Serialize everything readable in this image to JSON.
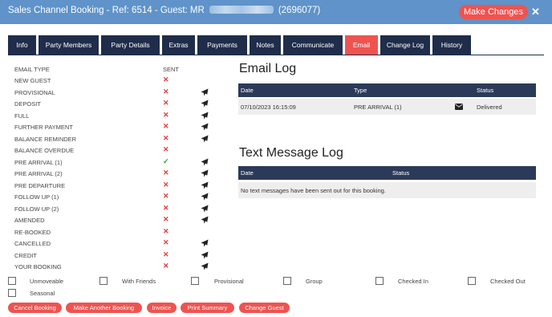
{
  "header": {
    "title_prefix": "Sales Channel Booking - Ref: 6514 - Guest: MR",
    "title_suffix": "(2696077)",
    "make_changes_label": "Make Changes",
    "close_glyph": "✕"
  },
  "tabs": [
    {
      "label": "Info"
    },
    {
      "label": "Party Members"
    },
    {
      "label": "Party Details"
    },
    {
      "label": "Extras"
    },
    {
      "label": "Payments"
    },
    {
      "label": "Notes"
    },
    {
      "label": "Communicate"
    },
    {
      "label": "Email",
      "active": true
    },
    {
      "label": "Change Log"
    },
    {
      "label": "History"
    }
  ],
  "email_types": {
    "header_type": "EMAIL TYPE",
    "header_sent": "SENT",
    "rows": [
      {
        "label": "NEW GUEST",
        "sent": false,
        "can_send": false
      },
      {
        "label": "PROVISIONAL",
        "sent": false,
        "can_send": true
      },
      {
        "label": "DEPOSIT",
        "sent": false,
        "can_send": true
      },
      {
        "label": "FULL",
        "sent": false,
        "can_send": true
      },
      {
        "label": "FURTHER PAYMENT",
        "sent": false,
        "can_send": true
      },
      {
        "label": "BALANCE REMINDER",
        "sent": false,
        "can_send": true
      },
      {
        "label": "BALANCE OVERDUE",
        "sent": false,
        "can_send": false
      },
      {
        "label": "PRE ARRIVAL (1)",
        "sent": true,
        "can_send": true
      },
      {
        "label": "PRE ARRIVAL (2)",
        "sent": false,
        "can_send": true
      },
      {
        "label": "PRE DEPARTURE",
        "sent": false,
        "can_send": true
      },
      {
        "label": "FOLLOW UP (1)",
        "sent": false,
        "can_send": true
      },
      {
        "label": "FOLLOW UP (2)",
        "sent": false,
        "can_send": true
      },
      {
        "label": "AMENDED",
        "sent": false,
        "can_send": true
      },
      {
        "label": "RE-BOOKED",
        "sent": false,
        "can_send": false
      },
      {
        "label": "CANCELLED",
        "sent": false,
        "can_send": true
      },
      {
        "label": "CREDIT",
        "sent": false,
        "can_send": true
      },
      {
        "label": "YOUR BOOKING",
        "sent": false,
        "can_send": true
      }
    ]
  },
  "email_log": {
    "heading": "Email Log",
    "col_date": "Date",
    "col_type": "Type",
    "col_status": "Status",
    "rows": [
      {
        "date": "07/10/2023 16:15:09",
        "type": "PRE ARRIVAL (1)",
        "status": "Delivered"
      }
    ]
  },
  "text_log": {
    "heading": "Text Message Log",
    "col_date": "Date",
    "col_status": "Status",
    "empty_message": "No text messages have been sent out for this booking."
  },
  "flags": [
    {
      "label": "Unmoveable",
      "checked": false
    },
    {
      "label": "With Friends",
      "checked": false
    },
    {
      "label": "Provisional",
      "checked": false
    },
    {
      "label": "Group",
      "checked": false
    },
    {
      "label": "Checked In",
      "checked": false
    },
    {
      "label": "Checked Out",
      "checked": false
    },
    {
      "label": "Seasonal",
      "checked": false
    }
  ],
  "actions": [
    {
      "label": "Cancel Booking"
    },
    {
      "label": "Make Another Booking"
    },
    {
      "label": "Invoice"
    },
    {
      "label": "Print Summary"
    },
    {
      "label": "Change Guest"
    }
  ],
  "colors": {
    "header_bg": "#5f93c9",
    "accent_red": "#ef5350",
    "tab_navy": "#1f2d4b",
    "table_head": "#2c3a5a",
    "check_green": "#2e9e48"
  }
}
